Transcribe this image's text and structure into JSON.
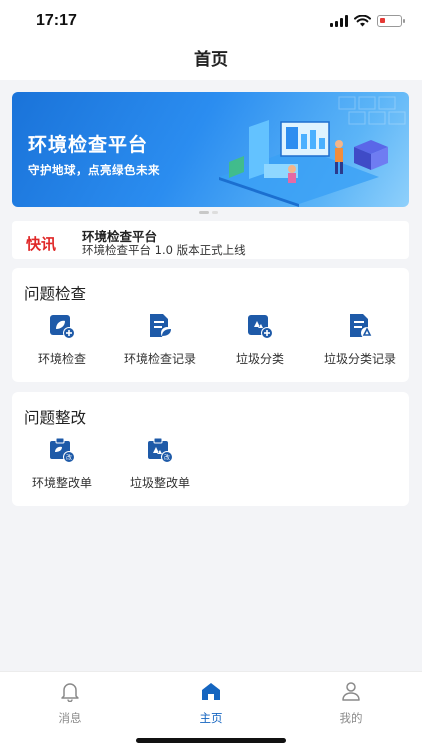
{
  "status": {
    "time": "17:17"
  },
  "header": {
    "title": "首页"
  },
  "banner": {
    "title": "环境检查平台",
    "subtitle": "守护地球，点亮绿色未来"
  },
  "news": {
    "tag": "快讯",
    "title": "环境检查平台",
    "desc": "环境检查平台 1.0 版本正式上线"
  },
  "inspection": {
    "title": "问题检查",
    "items": [
      {
        "label": "环境检查",
        "icon": "environment-check-icon"
      },
      {
        "label": "环境检查记录",
        "icon": "environment-record-icon"
      },
      {
        "label": "垃圾分类",
        "icon": "garbage-sort-icon"
      },
      {
        "label": "垃圾分类记录",
        "icon": "garbage-record-icon"
      }
    ]
  },
  "rectify": {
    "title": "问题整改",
    "items": [
      {
        "label": "环境整改单",
        "icon": "environment-rectify-icon"
      },
      {
        "label": "垃圾整改单",
        "icon": "garbage-rectify-icon"
      }
    ]
  },
  "tabs": [
    {
      "label": "消息",
      "icon": "bell-icon",
      "active": false
    },
    {
      "label": "主页",
      "icon": "home-icon",
      "active": true
    },
    {
      "label": "我的",
      "icon": "user-icon",
      "active": false
    }
  ],
  "colors": {
    "accent": "#1565c0",
    "news_tag": "#e02828"
  }
}
